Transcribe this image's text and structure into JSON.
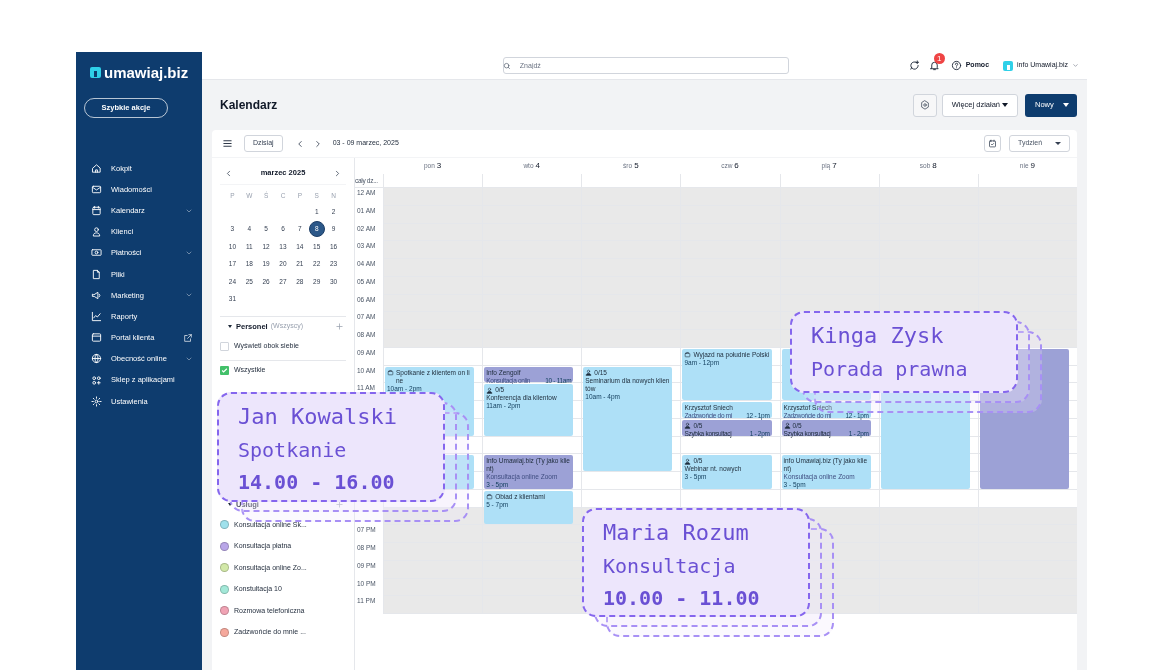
{
  "sidebar": {
    "logo": "umawiaj.biz",
    "quick_button": "Szybkie akcje",
    "items": [
      {
        "label": "Kokpit",
        "expandable": false,
        "external": false
      },
      {
        "label": "Wiadomości",
        "expandable": false,
        "external": false
      },
      {
        "label": "Kalendarz",
        "expandable": true,
        "external": false
      },
      {
        "label": "Klienci",
        "expandable": false,
        "external": false
      },
      {
        "label": "Płatności",
        "expandable": true,
        "external": false
      },
      {
        "label": "Pliki",
        "expandable": false,
        "external": false
      },
      {
        "label": "Marketing",
        "expandable": true,
        "external": false
      },
      {
        "label": "Raporty",
        "expandable": false,
        "external": false
      },
      {
        "label": "Portal klienta",
        "expandable": false,
        "external": true
      },
      {
        "label": "Obecność online",
        "expandable": true,
        "external": false
      },
      {
        "label": "Sklep z aplikacjami",
        "expandable": false,
        "external": false
      },
      {
        "label": "Ustawienia",
        "expandable": false,
        "external": false
      }
    ]
  },
  "header": {
    "search": {
      "placeholder": "Znajdź"
    },
    "notifications": "1",
    "help": "Pomoc",
    "account": "info Umawiaj.biz"
  },
  "page": {
    "title": "Kalendarz",
    "more_button": "Więcej działań",
    "new_button": "Nowy"
  },
  "toolbar": {
    "today": "Dzisiaj",
    "range": "03 - 09 marzec, 2025",
    "view": "Tydzień"
  },
  "mini_calendar": {
    "month": "marzec 2025",
    "weekdays": [
      "P",
      "W",
      "Ś",
      "C",
      "P",
      "S",
      "N"
    ],
    "weeks": [
      [
        {
          "day": "1",
          "selected": false
        },
        {
          "day": "2",
          "selected": false
        }
      ],
      [
        {
          "day": "3",
          "selected": false
        },
        {
          "day": "4",
          "selected": false
        },
        {
          "day": "5",
          "selected": false
        },
        {
          "day": "6",
          "selected": false
        },
        {
          "day": "7",
          "selected": false
        },
        {
          "day": "8",
          "selected": true
        },
        {
          "day": "9",
          "selected": false
        }
      ],
      [
        {
          "day": "10",
          "selected": false
        },
        {
          "day": "11",
          "selected": false
        },
        {
          "day": "12",
          "selected": false
        },
        {
          "day": "13",
          "selected": false
        },
        {
          "day": "14",
          "selected": false
        },
        {
          "day": "15",
          "selected": false
        },
        {
          "day": "16",
          "selected": false
        }
      ],
      [
        {
          "day": "17",
          "selected": false
        },
        {
          "day": "18",
          "selected": false
        },
        {
          "day": "19",
          "selected": false
        },
        {
          "day": "20",
          "selected": false
        },
        {
          "day": "21",
          "selected": false
        },
        {
          "day": "22",
          "selected": false
        },
        {
          "day": "23",
          "selected": false
        }
      ],
      [
        {
          "day": "24",
          "selected": false
        },
        {
          "day": "25",
          "selected": false
        },
        {
          "day": "26",
          "selected": false
        },
        {
          "day": "27",
          "selected": false
        },
        {
          "day": "28",
          "selected": false
        },
        {
          "day": "29",
          "selected": false
        },
        {
          "day": "30",
          "selected": false
        }
      ],
      [
        {
          "day": "31",
          "selected": false
        }
      ]
    ]
  },
  "personnel": {
    "title": "Personel",
    "filter": "(Wszyscy)",
    "options": [
      {
        "label": "Wyświetl obok siebie",
        "checked": false
      },
      {
        "label": "Wszystkie",
        "checked": true
      }
    ]
  },
  "services": {
    "title": "Usługi",
    "items": [
      {
        "label": "Konsultacja online Sk...",
        "color": "#9fe1ec"
      },
      {
        "label": "Konsultacja płatna",
        "color": "#b9a6e8"
      },
      {
        "label": "Konsultacja online Zo...",
        "color": "#d2e8a8"
      },
      {
        "label": "Konstultacja 10",
        "color": "#a3e8d8"
      },
      {
        "label": "Rozmowa telefoniczna",
        "color": "#f0a3b4"
      },
      {
        "label": "Zadzwońcie do mnie ...",
        "color": "#f5a89c"
      }
    ]
  },
  "calendar": {
    "all_day": "cały dz...",
    "morning_hours": [
      "12 AM",
      "01 AM",
      "02 AM",
      "03 AM",
      "04 AM",
      "05 AM",
      "06 AM",
      "07 AM",
      "08 AM",
      "09 AM",
      "10 AM",
      "11 AM"
    ],
    "evening_hours": [
      "07 PM",
      "08 PM",
      "09 PM",
      "10 PM",
      "11 PM"
    ],
    "days": [
      {
        "weekday": "pon",
        "date": "3",
        "events": [
          {
            "kind": "meeting",
            "color": "#aee0f7",
            "title": "Spotkanie z klientem on line",
            "time": "10am - 2pm"
          },
          {
            "kind": "booking",
            "color": "#aee0f7"
          }
        ]
      },
      {
        "weekday": "wto",
        "date": "4",
        "events": [
          {
            "kind": "booking",
            "color": "#9ca1d6",
            "title": "Info Zengolf",
            "subtitle": "Konsultacja onlin",
            "time": "10 - 11am",
            "time_inline": true
          },
          {
            "kind": "group",
            "color": "#aee0f7",
            "count": "0/5",
            "title": "Konferencja dla klientow",
            "time": "11am - 2pm"
          },
          {
            "kind": "booking",
            "color": "#9ca1d6",
            "title": "Info Umawiaj.biz (Ty jako klient)",
            "subtitle": "Konsultacja online Zoom",
            "time": "3 - 5pm"
          },
          {
            "kind": "meeting",
            "color": "#aee0f7",
            "title": "Obiad z klientami",
            "time": "5 - 7pm"
          }
        ]
      },
      {
        "weekday": "śro",
        "date": "5",
        "events": [
          {
            "kind": "group",
            "color": "#aee0f7",
            "count": "0/15",
            "title": "Seminarium dla nowych klientów",
            "time": "10am - 4pm"
          }
        ]
      },
      {
        "weekday": "czw",
        "date": "6",
        "events": [
          {
            "kind": "meeting",
            "color": "#aee0f7",
            "title": "Wyjazd na południe Polski",
            "time": "9am - 12pm"
          },
          {
            "kind": "booking",
            "color": "#aee0f7",
            "title": "Krzysztof Sniech",
            "subtitle": "Zadzwońcie do mi",
            "time": "12 - 1pm",
            "time_inline": true
          },
          {
            "kind": "group",
            "color": "#9ca1d6",
            "count": "0/5",
            "title": "Szybka konsultacj",
            "time": "1 - 2pm",
            "time_inline": true
          },
          {
            "kind": "group",
            "color": "#aee0f7",
            "count": "0/5",
            "title": "Webinar nt. nowych",
            "time": "3 - 5pm"
          }
        ]
      },
      {
        "weekday": "pią",
        "date": "7",
        "events": [
          {
            "kind": "booking",
            "color": "#aee0f7"
          },
          {
            "kind": "booking",
            "color": "#aee0f7",
            "title": "Krzysztof Sniech",
            "subtitle": "Zadzwońcie do mi",
            "time": "12 - 1pm",
            "time_inline": true
          },
          {
            "kind": "group",
            "color": "#9ca1d6",
            "count": "0/5",
            "title": "Szybka konsultacj",
            "time": "1 - 2pm",
            "time_inline": true
          },
          {
            "kind": "booking",
            "color": "#aee0f7",
            "title": "info Umawiaj.biz (Ty jako klient)",
            "subtitle": "Konsultacja online Zoom",
            "time": "3 - 5pm"
          }
        ]
      },
      {
        "weekday": "sob",
        "date": "8",
        "events": [
          {
            "kind": "booking",
            "color": "#aee0f7"
          }
        ]
      },
      {
        "weekday": "nie",
        "date": "9",
        "events": [
          {
            "kind": "booking",
            "color": "#9ca1d6"
          }
        ]
      }
    ]
  },
  "overlays": [
    {
      "name": "Jan Kowalski",
      "service": "Spotkanie",
      "time": "14.00 - 16.00"
    },
    {
      "name": "Kinga Zysk",
      "service": "Porada prawna"
    },
    {
      "name": "Maria Rozum",
      "service": "Konsultacja",
      "time": "10.00 - 11.00"
    }
  ]
}
